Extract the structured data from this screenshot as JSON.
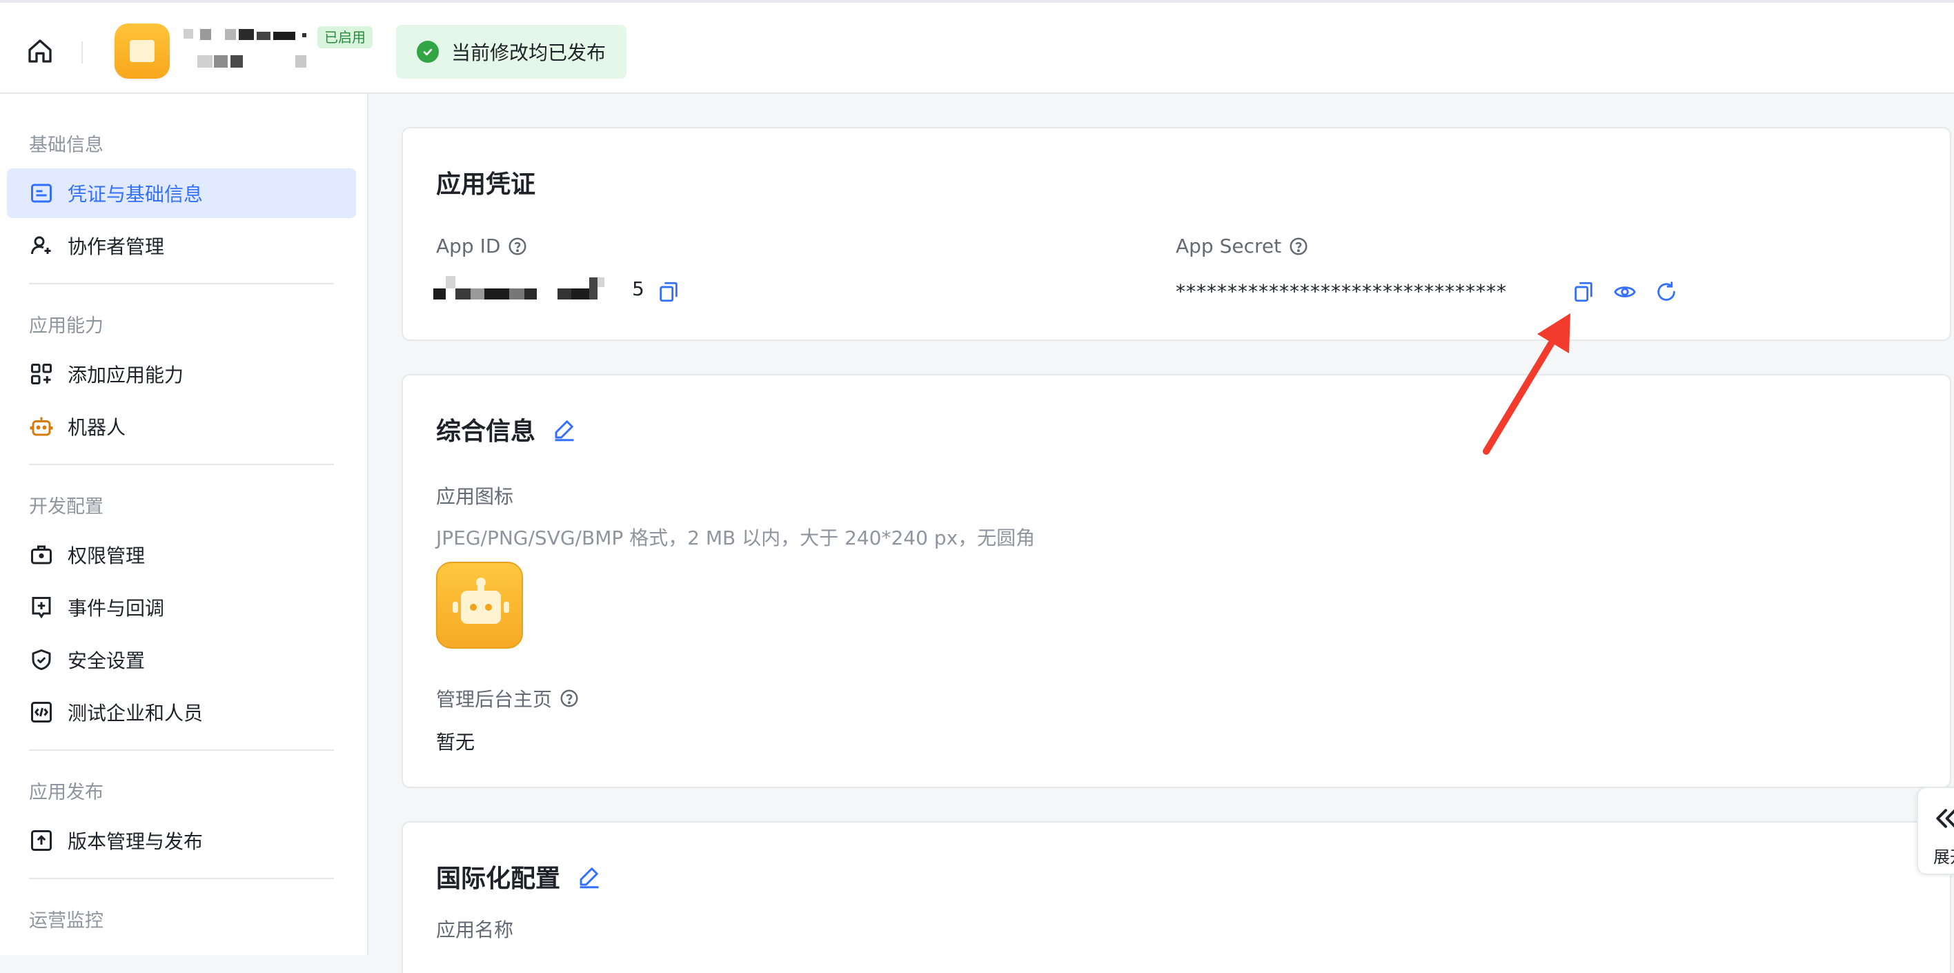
{
  "header": {
    "app_status": "已启用",
    "publish_status": "当前修改均已发布"
  },
  "sidebar": {
    "groups": [
      {
        "title": "基础信息",
        "items": [
          "凭证与基础信息",
          "协作者管理"
        ]
      },
      {
        "title": "应用能力",
        "items": [
          "添加应用能力",
          "机器人"
        ]
      },
      {
        "title": "开发配置",
        "items": [
          "权限管理",
          "事件与回调",
          "安全设置",
          "测试企业和人员"
        ]
      },
      {
        "title": "应用发布",
        "items": [
          "版本管理与发布"
        ]
      },
      {
        "title": "运营监控",
        "items": []
      }
    ],
    "active_item": "凭证与基础信息"
  },
  "credentials": {
    "title": "应用凭证",
    "app_id_label": "App ID",
    "app_id_visible_suffix": "5",
    "app_secret_label": "App Secret",
    "app_secret_value": "********************************"
  },
  "general": {
    "title": "综合信息",
    "icon_label": "应用图标",
    "icon_hint": "JPEG/PNG/SVG/BMP 格式，2 MB 以内，大于 240*240 px，无圆角",
    "admin_home_label": "管理后台主页",
    "admin_home_value": "暂无"
  },
  "i18n": {
    "title": "国际化配置",
    "app_name_label": "应用名称"
  },
  "expand_tab": {
    "label": "展开"
  },
  "colors": {
    "accent": "#3370ff",
    "annotation_arrow": "#f23b2c",
    "success": "#32a645"
  },
  "icons": [
    "home-icon",
    "check-circle-icon",
    "copy-icon",
    "eye-icon",
    "refresh-icon",
    "edit-icon",
    "help-icon",
    "robot-icon"
  ]
}
